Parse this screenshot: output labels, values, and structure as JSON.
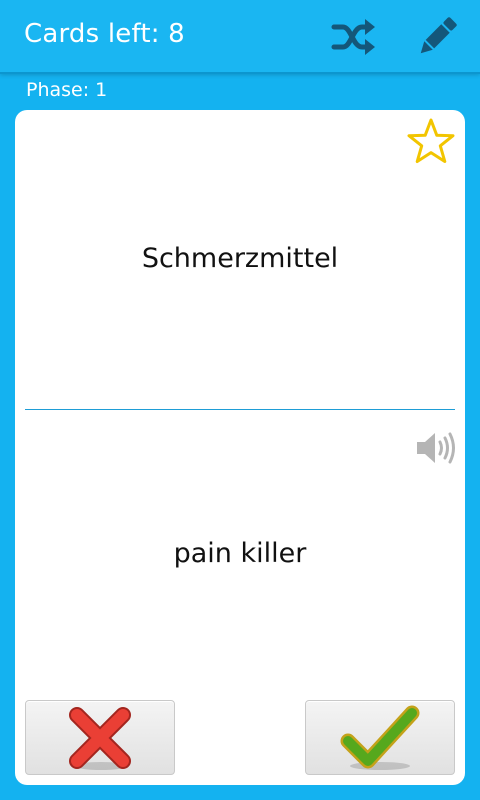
{
  "action_bar": {
    "title": "Cards left: 8",
    "icons": [
      "shuffle-icon",
      "pencil-icon"
    ]
  },
  "phase_label": "Phase: 1",
  "card": {
    "front_text": "Schmerzmittel",
    "back_text": "pain killer",
    "icons": [
      "star-outline-icon",
      "speaker-icon"
    ]
  },
  "buttons": {
    "wrong_icon": "red-x-icon",
    "right_icon": "green-checkmark-icon"
  },
  "colors": {
    "background": "#14b2f0",
    "action_bar": "#1ab6f2",
    "icon_dark_blue": "#14577a",
    "star_gold": "#f2c500",
    "divider": "#1e9dd6",
    "wrong_red": "#e23a32",
    "right_green": "#56a81d"
  }
}
